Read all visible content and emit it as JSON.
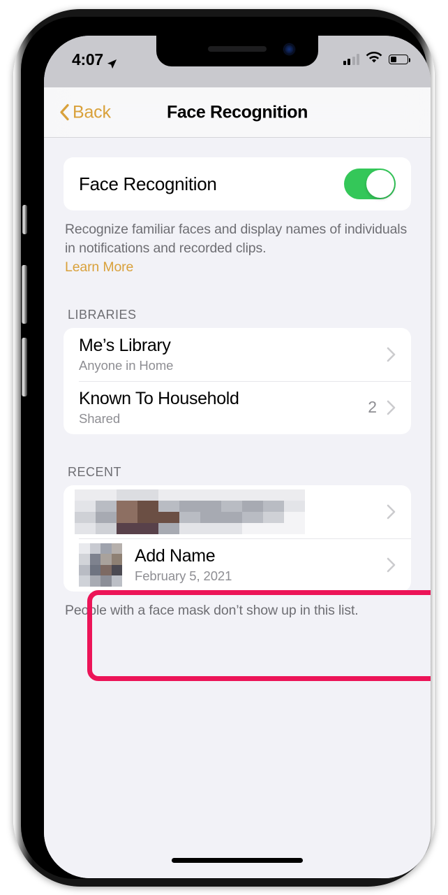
{
  "status_bar": {
    "time": "4:07",
    "location_icon": "location-arrow-icon",
    "cellular_icon": "cellular-bars-icon",
    "cellular_bars_active": 2,
    "wifi_icon": "wifi-icon",
    "battery_icon": "battery-icon",
    "battery_level_percent": 38
  },
  "nav_bar": {
    "back_label": "Back",
    "back_icon": "chevron-left-icon",
    "title": "Face Recognition"
  },
  "toggle_section": {
    "label": "Face Recognition",
    "enabled": true,
    "switch_on_color": "#34C759",
    "footnote": "Recognize familiar faces and display names of individuals in notifications and recorded clips.",
    "learn_more_label": "Learn More",
    "link_color": "#D9A13B"
  },
  "libraries_section": {
    "header": "LIBRARIES",
    "rows": [
      {
        "title": "Me’s Library",
        "subtitle": "Anyone in Home",
        "count": "",
        "chevron_icon": "chevron-right-icon"
      },
      {
        "title": "Known To Household",
        "subtitle": "Shared",
        "count": "2",
        "chevron_icon": "chevron-right-icon"
      }
    ]
  },
  "recent_section": {
    "header": "RECENT",
    "rows": [
      {
        "title": "",
        "subtitle": "",
        "redacted": true,
        "avatar_icon": "pixelated-face-avatar",
        "chevron_icon": "chevron-right-icon"
      },
      {
        "title": "Add Name",
        "subtitle": "February 5, 2021",
        "redacted": false,
        "avatar_icon": "pixelated-face-avatar",
        "chevron_icon": "chevron-right-icon"
      }
    ],
    "footnote": "People with a face mask don’t show up in this list."
  },
  "annotation": {
    "highlight_color": "#EC1458",
    "target_row": "Add Name"
  },
  "home_indicator": "home-indicator"
}
